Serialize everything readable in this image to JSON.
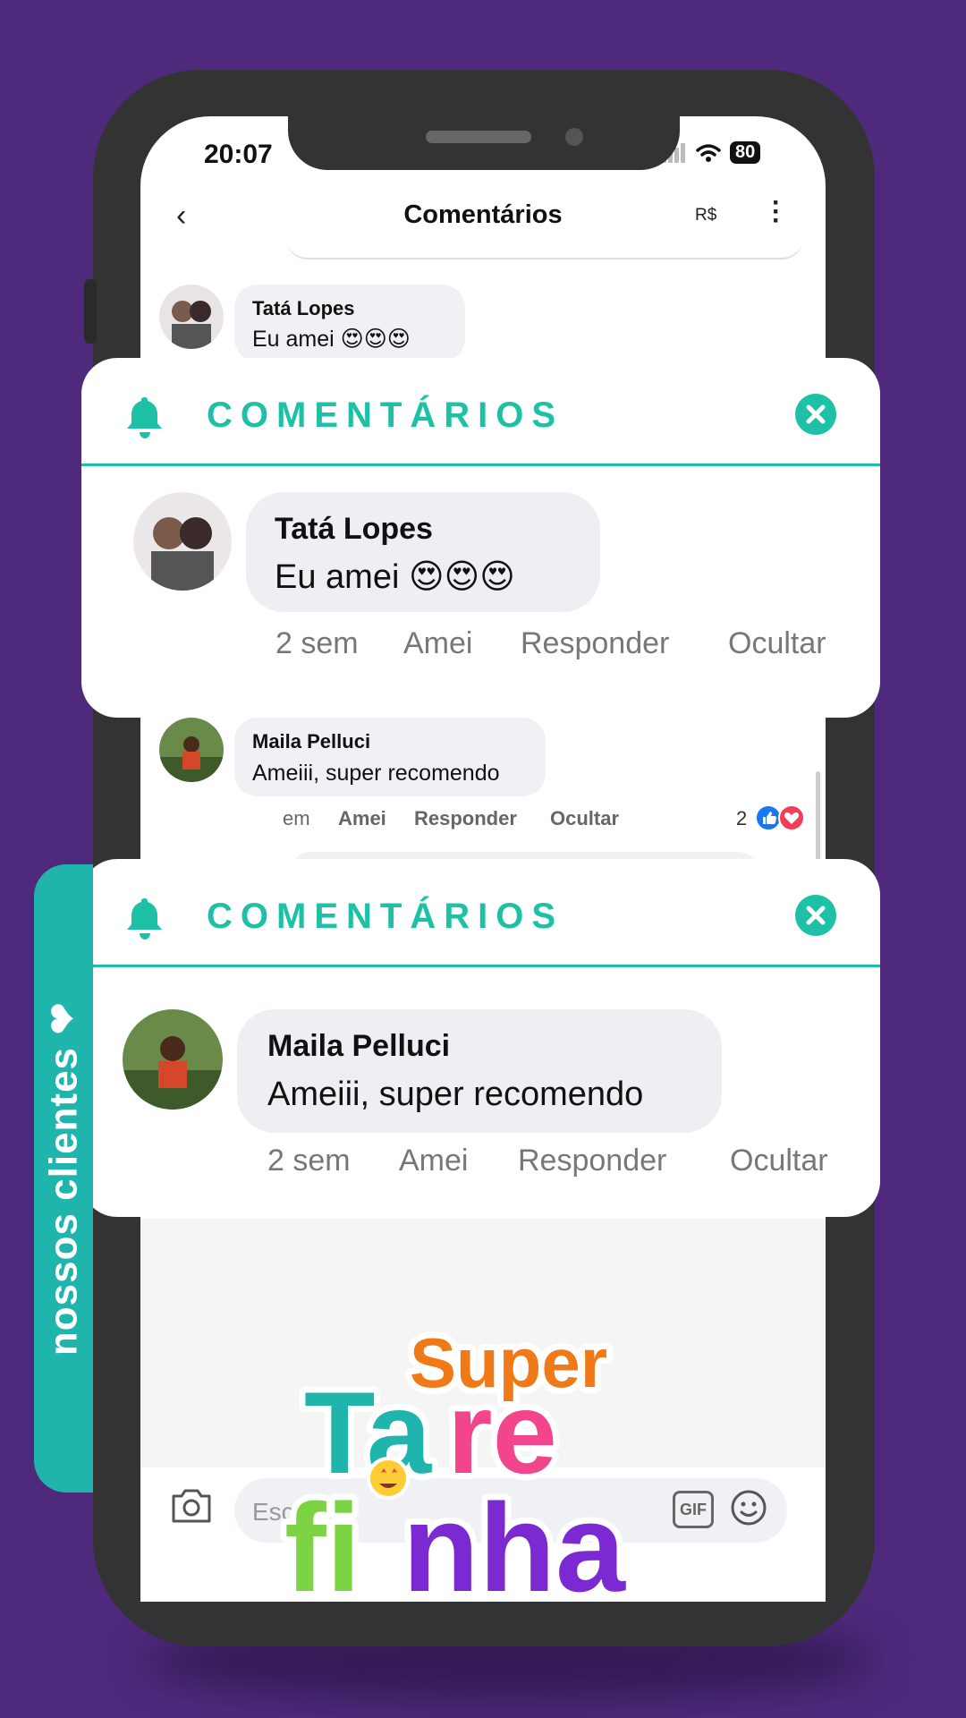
{
  "status_bar": {
    "time": "20:07",
    "battery": "80"
  },
  "header": {
    "title": "Comentários",
    "currency_label": "R$"
  },
  "feed": {
    "comment1": {
      "name": "Tatá Lopes",
      "text": "Eu amei 😍😍😍"
    },
    "comment2": {
      "name": "Maila Pelluci",
      "text": "Ameiii, super recomendo",
      "time_partial": "em",
      "like_label": "Amei",
      "reply_label": "Responder",
      "hide_label": "Ocultar",
      "reaction_count": "2"
    }
  },
  "card1": {
    "title": "COMENTÁRIOS",
    "name": "Tatá Lopes",
    "text": "Eu amei 😍😍😍",
    "time": "2 sem",
    "like_label": "Amei",
    "reply_label": "Responder",
    "hide_label": "Ocultar"
  },
  "card2": {
    "title": "COMENTÁRIOS",
    "name": "Maila Pelluci",
    "text": "Ameiii, super recomendo",
    "time": "2 sem",
    "like_label": "Amei",
    "reply_label": "Responder",
    "hide_label": "Ocultar"
  },
  "composer": {
    "placeholder": "Esc",
    "gif_label": "GIF"
  },
  "side_tab": {
    "label": "nossos clientes ❤"
  },
  "logo": {
    "line1": "Super",
    "line2": "Tare",
    "line3": "finha"
  },
  "colors": {
    "background": "#4f2a7c",
    "accent": "#1fc1a6",
    "love": "#e5425a",
    "orange": "#f07a18",
    "teal": "#1fb5ac",
    "pink": "#f2458c",
    "green": "#7cd343",
    "purple": "#7b2ad1"
  }
}
